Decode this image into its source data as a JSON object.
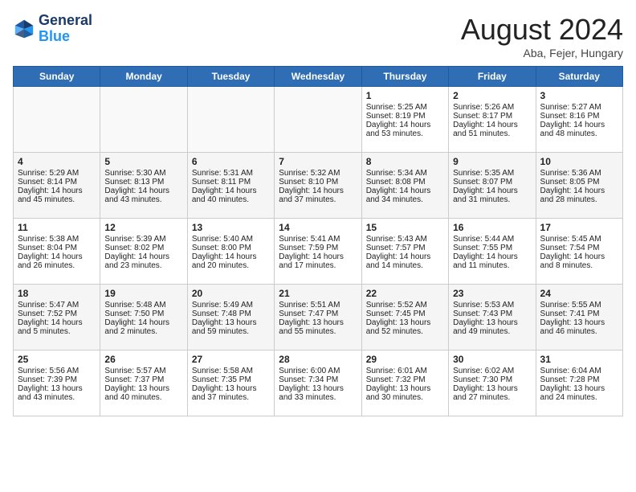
{
  "header": {
    "logo_line1": "General",
    "logo_line2": "Blue",
    "month_title": "August 2024",
    "subtitle": "Aba, Fejer, Hungary"
  },
  "days_of_week": [
    "Sunday",
    "Monday",
    "Tuesday",
    "Wednesday",
    "Thursday",
    "Friday",
    "Saturday"
  ],
  "weeks": [
    [
      {
        "day": "",
        "info": ""
      },
      {
        "day": "",
        "info": ""
      },
      {
        "day": "",
        "info": ""
      },
      {
        "day": "",
        "info": ""
      },
      {
        "day": "1",
        "info": "Sunrise: 5:25 AM\nSunset: 8:19 PM\nDaylight: 14 hours\nand 53 minutes."
      },
      {
        "day": "2",
        "info": "Sunrise: 5:26 AM\nSunset: 8:17 PM\nDaylight: 14 hours\nand 51 minutes."
      },
      {
        "day": "3",
        "info": "Sunrise: 5:27 AM\nSunset: 8:16 PM\nDaylight: 14 hours\nand 48 minutes."
      }
    ],
    [
      {
        "day": "4",
        "info": "Sunrise: 5:29 AM\nSunset: 8:14 PM\nDaylight: 14 hours\nand 45 minutes."
      },
      {
        "day": "5",
        "info": "Sunrise: 5:30 AM\nSunset: 8:13 PM\nDaylight: 14 hours\nand 43 minutes."
      },
      {
        "day": "6",
        "info": "Sunrise: 5:31 AM\nSunset: 8:11 PM\nDaylight: 14 hours\nand 40 minutes."
      },
      {
        "day": "7",
        "info": "Sunrise: 5:32 AM\nSunset: 8:10 PM\nDaylight: 14 hours\nand 37 minutes."
      },
      {
        "day": "8",
        "info": "Sunrise: 5:34 AM\nSunset: 8:08 PM\nDaylight: 14 hours\nand 34 minutes."
      },
      {
        "day": "9",
        "info": "Sunrise: 5:35 AM\nSunset: 8:07 PM\nDaylight: 14 hours\nand 31 minutes."
      },
      {
        "day": "10",
        "info": "Sunrise: 5:36 AM\nSunset: 8:05 PM\nDaylight: 14 hours\nand 28 minutes."
      }
    ],
    [
      {
        "day": "11",
        "info": "Sunrise: 5:38 AM\nSunset: 8:04 PM\nDaylight: 14 hours\nand 26 minutes."
      },
      {
        "day": "12",
        "info": "Sunrise: 5:39 AM\nSunset: 8:02 PM\nDaylight: 14 hours\nand 23 minutes."
      },
      {
        "day": "13",
        "info": "Sunrise: 5:40 AM\nSunset: 8:00 PM\nDaylight: 14 hours\nand 20 minutes."
      },
      {
        "day": "14",
        "info": "Sunrise: 5:41 AM\nSunset: 7:59 PM\nDaylight: 14 hours\nand 17 minutes."
      },
      {
        "day": "15",
        "info": "Sunrise: 5:43 AM\nSunset: 7:57 PM\nDaylight: 14 hours\nand 14 minutes."
      },
      {
        "day": "16",
        "info": "Sunrise: 5:44 AM\nSunset: 7:55 PM\nDaylight: 14 hours\nand 11 minutes."
      },
      {
        "day": "17",
        "info": "Sunrise: 5:45 AM\nSunset: 7:54 PM\nDaylight: 14 hours\nand 8 minutes."
      }
    ],
    [
      {
        "day": "18",
        "info": "Sunrise: 5:47 AM\nSunset: 7:52 PM\nDaylight: 14 hours\nand 5 minutes."
      },
      {
        "day": "19",
        "info": "Sunrise: 5:48 AM\nSunset: 7:50 PM\nDaylight: 14 hours\nand 2 minutes."
      },
      {
        "day": "20",
        "info": "Sunrise: 5:49 AM\nSunset: 7:48 PM\nDaylight: 13 hours\nand 59 minutes."
      },
      {
        "day": "21",
        "info": "Sunrise: 5:51 AM\nSunset: 7:47 PM\nDaylight: 13 hours\nand 55 minutes."
      },
      {
        "day": "22",
        "info": "Sunrise: 5:52 AM\nSunset: 7:45 PM\nDaylight: 13 hours\nand 52 minutes."
      },
      {
        "day": "23",
        "info": "Sunrise: 5:53 AM\nSunset: 7:43 PM\nDaylight: 13 hours\nand 49 minutes."
      },
      {
        "day": "24",
        "info": "Sunrise: 5:55 AM\nSunset: 7:41 PM\nDaylight: 13 hours\nand 46 minutes."
      }
    ],
    [
      {
        "day": "25",
        "info": "Sunrise: 5:56 AM\nSunset: 7:39 PM\nDaylight: 13 hours\nand 43 minutes."
      },
      {
        "day": "26",
        "info": "Sunrise: 5:57 AM\nSunset: 7:37 PM\nDaylight: 13 hours\nand 40 minutes."
      },
      {
        "day": "27",
        "info": "Sunrise: 5:58 AM\nSunset: 7:35 PM\nDaylight: 13 hours\nand 37 minutes."
      },
      {
        "day": "28",
        "info": "Sunrise: 6:00 AM\nSunset: 7:34 PM\nDaylight: 13 hours\nand 33 minutes."
      },
      {
        "day": "29",
        "info": "Sunrise: 6:01 AM\nSunset: 7:32 PM\nDaylight: 13 hours\nand 30 minutes."
      },
      {
        "day": "30",
        "info": "Sunrise: 6:02 AM\nSunset: 7:30 PM\nDaylight: 13 hours\nand 27 minutes."
      },
      {
        "day": "31",
        "info": "Sunrise: 6:04 AM\nSunset: 7:28 PM\nDaylight: 13 hours\nand 24 minutes."
      }
    ]
  ]
}
